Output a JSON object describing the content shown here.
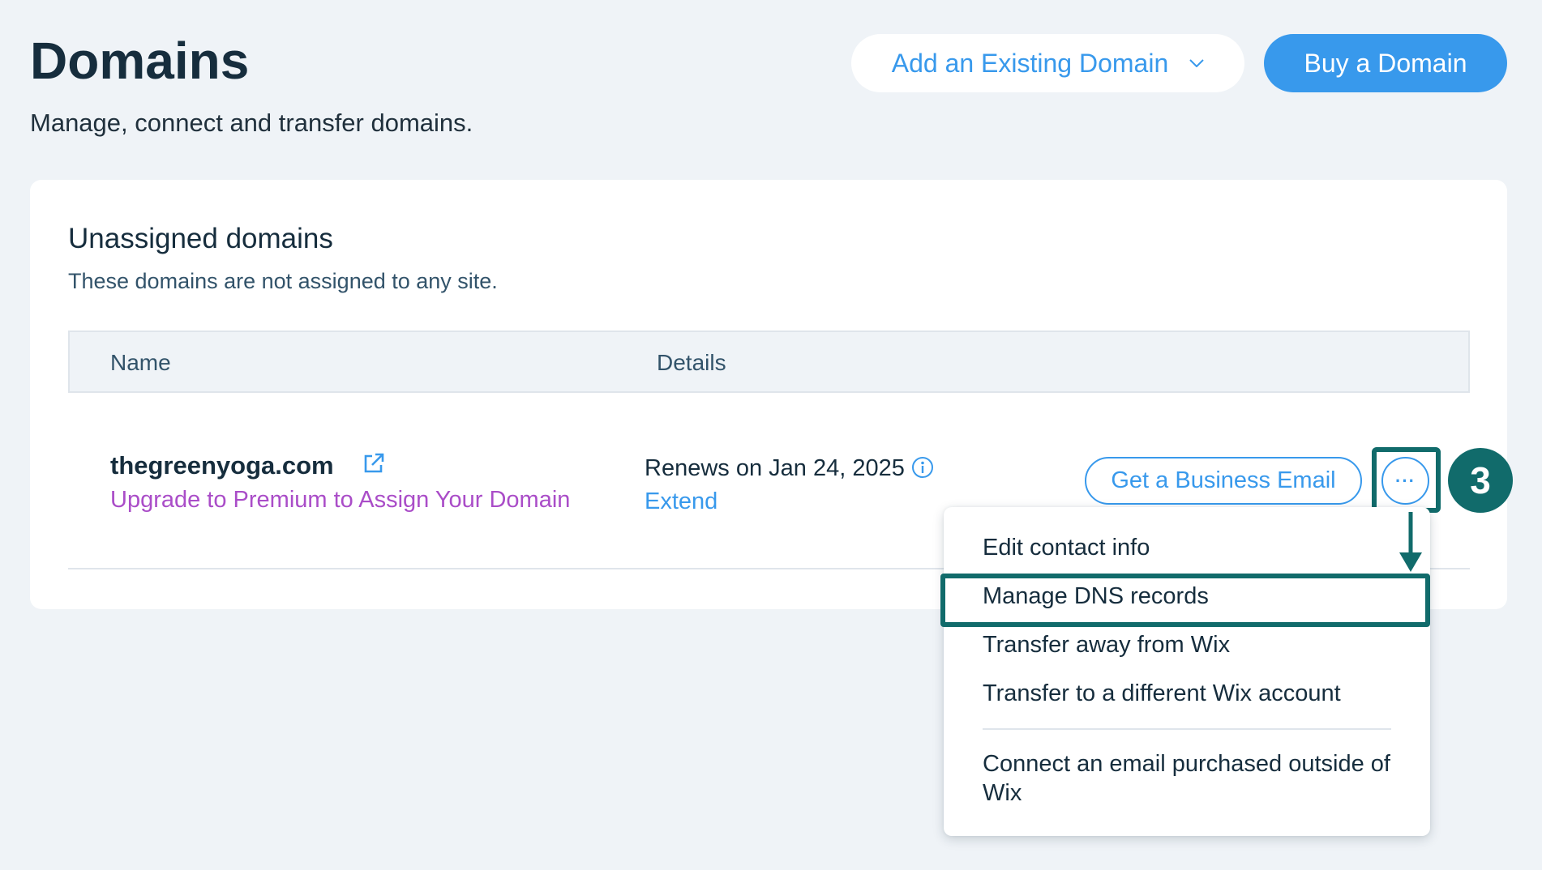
{
  "header": {
    "title": "Domains",
    "subtitle": "Manage, connect and transfer domains.",
    "add_existing_label": "Add an Existing Domain",
    "buy_label": "Buy a Domain"
  },
  "section": {
    "title": "Unassigned domains",
    "description": "These domains are not assigned to any site."
  },
  "table": {
    "columns": [
      "Name",
      "Details"
    ],
    "rows": [
      {
        "domain": "thegreenyoga.com",
        "upgrade_link": "Upgrade to Premium to Assign Your Domain",
        "renews": "Renews on Jan 24, 2025",
        "extend": "Extend",
        "email_button": "Get a Business Email",
        "more_button": "···"
      }
    ]
  },
  "menu": {
    "items": [
      "Edit contact info",
      "Manage DNS records",
      "Transfer away from Wix",
      "Transfer to a different Wix account",
      "Connect an email purchased outside of Wix"
    ],
    "highlighted": "Manage DNS records"
  },
  "annotation": {
    "step": "3"
  },
  "colors": {
    "accent": "#3899ec",
    "highlight": "#116b6b",
    "upgrade": "#aa4dc8",
    "text": "#162d3d",
    "background": "#eff3f7"
  },
  "icons": [
    "chevron-down-icon",
    "external-link-icon",
    "info-icon",
    "more-icon",
    "arrow-down-icon"
  ]
}
